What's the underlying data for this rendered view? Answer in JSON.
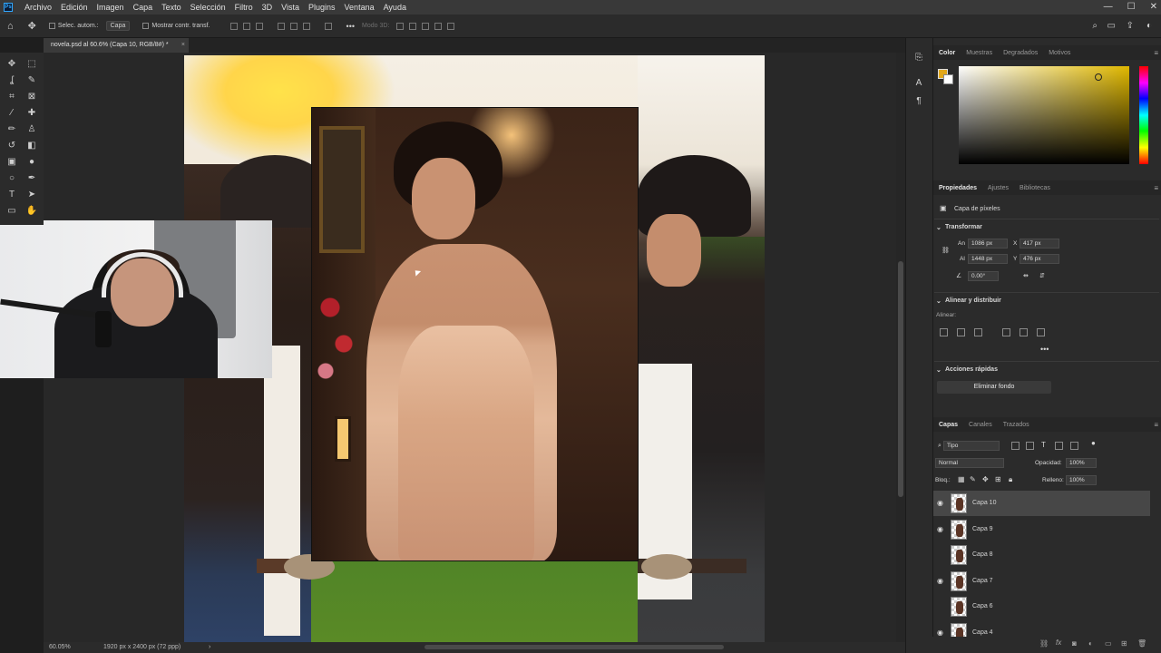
{
  "menu": {
    "items": [
      "Archivo",
      "Edición",
      "Imagen",
      "Capa",
      "Texto",
      "Selección",
      "Filtro",
      "3D",
      "Vista",
      "Plugins",
      "Ventana",
      "Ayuda"
    ]
  },
  "options": {
    "auto_select": "Selec. autom.:",
    "target": "Capa",
    "show_transform": "Mostrar contr. transf.",
    "mode3d": "Modo 3D:",
    "more": "•••"
  },
  "doc": {
    "tab_title": "novela.psd al 60.6% (Capa 10, RGB/8#) *",
    "close": "×"
  },
  "status": {
    "zoom": "60.05%",
    "dims": "1920 px x 2400 px (72 ppp)",
    "arrow": "›"
  },
  "color_panel": {
    "tabs": [
      "Color",
      "Muestras",
      "Degradados",
      "Motivos"
    ],
    "fg": "#e2a81b",
    "bg": "#ffffff"
  },
  "props_panel": {
    "tabs": [
      "Propiedades",
      "Ajustes",
      "Bibliotecas"
    ],
    "layer_type": "Capa de píxeles",
    "transform_title": "Transformar",
    "w_label": "An",
    "w": "1086 px",
    "x_label": "X",
    "x": "417 px",
    "h_label": "Al",
    "h": "1448 px",
    "y_label": "Y",
    "y": "476 px",
    "angle": "0.00°",
    "align_title": "Alinear y distribuir",
    "align_label": "Alinear:",
    "quick_title": "Acciones rápidas",
    "remove_bg": "Eliminar fondo"
  },
  "layers_panel": {
    "tabs": [
      "Capas",
      "Canales",
      "Trazados"
    ],
    "filter": "Tipo",
    "blend": "Normal",
    "opacity_label": "Opacidad:",
    "opacity": "100%",
    "lock_label": "Bloq.:",
    "fill_label": "Relleno:",
    "fill": "100%",
    "layers": [
      {
        "name": "Capa 10",
        "visible": true,
        "selected": true
      },
      {
        "name": "Capa 9",
        "visible": true,
        "selected": false
      },
      {
        "name": "Capa 8",
        "visible": false,
        "selected": false
      },
      {
        "name": "Capa 7",
        "visible": true,
        "selected": false
      },
      {
        "name": "Capa 6",
        "visible": false,
        "selected": false
      },
      {
        "name": "Capa 4",
        "visible": true,
        "selected": false
      }
    ]
  },
  "icons": {
    "eye": "◉",
    "fx": "fx"
  }
}
